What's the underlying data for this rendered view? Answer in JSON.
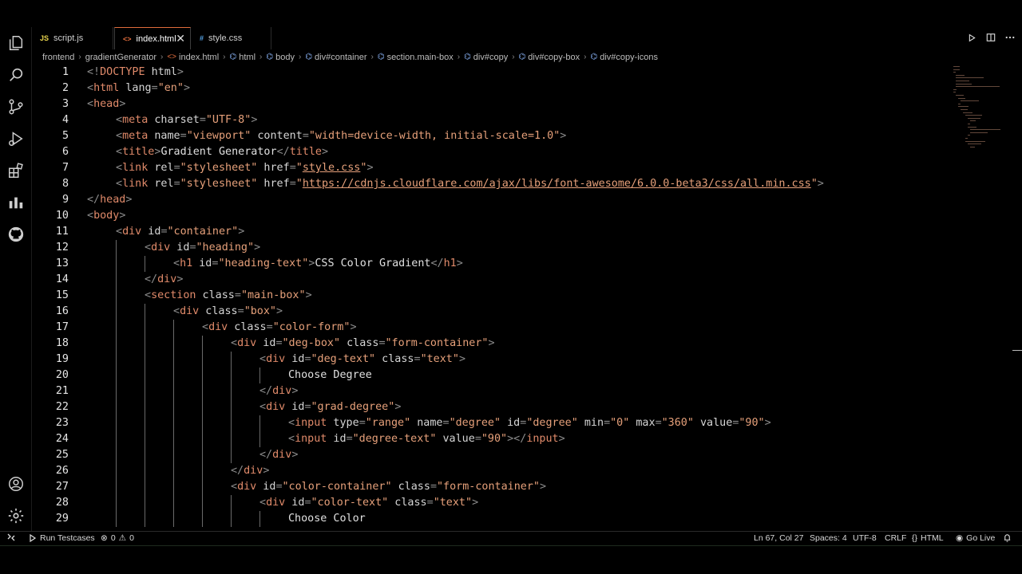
{
  "tabs": [
    {
      "icon": "JS",
      "label": "script.js",
      "active": false
    },
    {
      "icon": "<>",
      "label": "index.html",
      "active": true,
      "close": "✕"
    },
    {
      "icon": "#",
      "label": "style.css",
      "active": false
    }
  ],
  "breadcrumb": [
    "frontend",
    "gradientGenerator",
    "index.html",
    "html",
    "body",
    "div#container",
    "section.main-box",
    "div#copy",
    "div#copy-box",
    "div#copy-icons"
  ],
  "code_lines": [
    {
      "n": "1",
      "indent": 0,
      "tokens": [
        [
          "d",
          "<!"
        ],
        [
          "t",
          "DOCTYPE"
        ],
        [
          "a",
          " html"
        ],
        [
          "d",
          ">"
        ]
      ]
    },
    {
      "n": "2",
      "indent": 0,
      "tokens": [
        [
          "d",
          "<"
        ],
        [
          "t",
          "html"
        ],
        [
          "a",
          " lang"
        ],
        [
          "d",
          "="
        ],
        [
          "s",
          "\"en\""
        ],
        [
          "d",
          ">"
        ]
      ]
    },
    {
      "n": "3",
      "indent": 0,
      "tokens": [
        [
          "d",
          "<"
        ],
        [
          "t",
          "head"
        ],
        [
          "d",
          ">"
        ]
      ]
    },
    {
      "n": "4",
      "indent": 1,
      "tokens": [
        [
          "d",
          "<"
        ],
        [
          "t",
          "meta"
        ],
        [
          "a",
          " charset"
        ],
        [
          "d",
          "="
        ],
        [
          "s",
          "\"UTF-8\""
        ],
        [
          "d",
          ">"
        ]
      ]
    },
    {
      "n": "5",
      "indent": 1,
      "tokens": [
        [
          "d",
          "<"
        ],
        [
          "t",
          "meta"
        ],
        [
          "a",
          " name"
        ],
        [
          "d",
          "="
        ],
        [
          "s",
          "\"viewport\""
        ],
        [
          "a",
          " content"
        ],
        [
          "d",
          "="
        ],
        [
          "s",
          "\"width=device-width, initial-scale=1.0\""
        ],
        [
          "d",
          ">"
        ]
      ]
    },
    {
      "n": "6",
      "indent": 1,
      "tokens": [
        [
          "d",
          "<"
        ],
        [
          "t",
          "title"
        ],
        [
          "d",
          ">"
        ],
        [
          "x",
          "Gradient Generator"
        ],
        [
          "d",
          "</"
        ],
        [
          "t",
          "title"
        ],
        [
          "d",
          ">"
        ]
      ]
    },
    {
      "n": "7",
      "indent": 1,
      "tokens": [
        [
          "d",
          "<"
        ],
        [
          "t",
          "link"
        ],
        [
          "a",
          " rel"
        ],
        [
          "d",
          "="
        ],
        [
          "s",
          "\"stylesheet\""
        ],
        [
          "a",
          " href"
        ],
        [
          "d",
          "="
        ],
        [
          "s",
          "\""
        ],
        [
          "u",
          "style.css"
        ],
        [
          "s",
          "\""
        ],
        [
          "d",
          ">"
        ]
      ]
    },
    {
      "n": "8",
      "indent": 1,
      "tokens": [
        [
          "d",
          "<"
        ],
        [
          "t",
          "link"
        ],
        [
          "a",
          " rel"
        ],
        [
          "d",
          "="
        ],
        [
          "s",
          "\"stylesheet\""
        ],
        [
          "a",
          " href"
        ],
        [
          "d",
          "="
        ],
        [
          "s",
          "\""
        ],
        [
          "u",
          "https://cdnjs.cloudflare.com/ajax/libs/font-awesome/6.0.0-beta3/css/all.min.css"
        ],
        [
          "s",
          "\""
        ],
        [
          "d",
          ">"
        ]
      ]
    },
    {
      "n": "9",
      "indent": 0,
      "tokens": [
        [
          "d",
          "</"
        ],
        [
          "t",
          "head"
        ],
        [
          "d",
          ">"
        ]
      ]
    },
    {
      "n": "10",
      "indent": 0,
      "tokens": [
        [
          "d",
          "<"
        ],
        [
          "t",
          "body"
        ],
        [
          "d",
          ">"
        ]
      ]
    },
    {
      "n": "11",
      "indent": 1,
      "tokens": [
        [
          "d",
          "<"
        ],
        [
          "t",
          "div"
        ],
        [
          "a",
          " id"
        ],
        [
          "d",
          "="
        ],
        [
          "s",
          "\"container\""
        ],
        [
          "d",
          ">"
        ]
      ]
    },
    {
      "n": "12",
      "indent": 2,
      "tokens": [
        [
          "d",
          "<"
        ],
        [
          "t",
          "div"
        ],
        [
          "a",
          " id"
        ],
        [
          "d",
          "="
        ],
        [
          "s",
          "\"heading\""
        ],
        [
          "d",
          ">"
        ]
      ]
    },
    {
      "n": "13",
      "indent": 3,
      "tokens": [
        [
          "d",
          "<"
        ],
        [
          "t",
          "h1"
        ],
        [
          "a",
          " id"
        ],
        [
          "d",
          "="
        ],
        [
          "s",
          "\"heading-text\""
        ],
        [
          "d",
          ">"
        ],
        [
          "x",
          "CSS Color Gradient"
        ],
        [
          "d",
          "</"
        ],
        [
          "t",
          "h1"
        ],
        [
          "d",
          ">"
        ]
      ]
    },
    {
      "n": "14",
      "indent": 2,
      "tokens": [
        [
          "d",
          "</"
        ],
        [
          "t",
          "div"
        ],
        [
          "d",
          ">"
        ]
      ]
    },
    {
      "n": "15",
      "indent": 2,
      "tokens": [
        [
          "d",
          "<"
        ],
        [
          "t",
          "section"
        ],
        [
          "a",
          " class"
        ],
        [
          "d",
          "="
        ],
        [
          "s",
          "\"main-box\""
        ],
        [
          "d",
          ">"
        ]
      ]
    },
    {
      "n": "16",
      "indent": 3,
      "tokens": [
        [
          "d",
          "<"
        ],
        [
          "t",
          "div"
        ],
        [
          "a",
          " class"
        ],
        [
          "d",
          "="
        ],
        [
          "s",
          "\"box\""
        ],
        [
          "d",
          ">"
        ]
      ]
    },
    {
      "n": "17",
      "indent": 4,
      "tokens": [
        [
          "d",
          "<"
        ],
        [
          "t",
          "div"
        ],
        [
          "a",
          " class"
        ],
        [
          "d",
          "="
        ],
        [
          "s",
          "\"color-form\""
        ],
        [
          "d",
          ">"
        ]
      ]
    },
    {
      "n": "18",
      "indent": 5,
      "tokens": [
        [
          "d",
          "<"
        ],
        [
          "t",
          "div"
        ],
        [
          "a",
          " id"
        ],
        [
          "d",
          "="
        ],
        [
          "s",
          "\"deg-box\""
        ],
        [
          "a",
          " class"
        ],
        [
          "d",
          "="
        ],
        [
          "s",
          "\"form-container\""
        ],
        [
          "d",
          ">"
        ]
      ]
    },
    {
      "n": "19",
      "indent": 6,
      "tokens": [
        [
          "d",
          "<"
        ],
        [
          "t",
          "div"
        ],
        [
          "a",
          " id"
        ],
        [
          "d",
          "="
        ],
        [
          "s",
          "\"deg-text\""
        ],
        [
          "a",
          " class"
        ],
        [
          "d",
          "="
        ],
        [
          "s",
          "\"text\""
        ],
        [
          "d",
          ">"
        ]
      ]
    },
    {
      "n": "20",
      "indent": 7,
      "tokens": [
        [
          "x",
          "Choose Degree"
        ]
      ]
    },
    {
      "n": "21",
      "indent": 6,
      "tokens": [
        [
          "d",
          "</"
        ],
        [
          "t",
          "div"
        ],
        [
          "d",
          ">"
        ]
      ]
    },
    {
      "n": "22",
      "indent": 6,
      "tokens": [
        [
          "d",
          "<"
        ],
        [
          "t",
          "div"
        ],
        [
          "a",
          " id"
        ],
        [
          "d",
          "="
        ],
        [
          "s",
          "\"grad-degree\""
        ],
        [
          "d",
          ">"
        ]
      ]
    },
    {
      "n": "23",
      "indent": 7,
      "tokens": [
        [
          "d",
          "<"
        ],
        [
          "t",
          "input"
        ],
        [
          "a",
          " type"
        ],
        [
          "d",
          "="
        ],
        [
          "s",
          "\"range\""
        ],
        [
          "a",
          " name"
        ],
        [
          "d",
          "="
        ],
        [
          "s",
          "\"degree\""
        ],
        [
          "a",
          " id"
        ],
        [
          "d",
          "="
        ],
        [
          "s",
          "\"degree\""
        ],
        [
          "a",
          " min"
        ],
        [
          "d",
          "="
        ],
        [
          "s",
          "\"0\""
        ],
        [
          "a",
          " max"
        ],
        [
          "d",
          "="
        ],
        [
          "s",
          "\"360\""
        ],
        [
          "a",
          " value"
        ],
        [
          "d",
          "="
        ],
        [
          "s",
          "\"90\""
        ],
        [
          "d",
          ">"
        ]
      ]
    },
    {
      "n": "24",
      "indent": 7,
      "tokens": [
        [
          "d",
          "<"
        ],
        [
          "t",
          "input"
        ],
        [
          "a",
          " id"
        ],
        [
          "d",
          "="
        ],
        [
          "s",
          "\"degree-text\""
        ],
        [
          "a",
          " value"
        ],
        [
          "d",
          "="
        ],
        [
          "s",
          "\"90\""
        ],
        [
          "d",
          "></"
        ],
        [
          "t",
          "input"
        ],
        [
          "d",
          ">"
        ]
      ]
    },
    {
      "n": "25",
      "indent": 6,
      "tokens": [
        [
          "d",
          "</"
        ],
        [
          "t",
          "div"
        ],
        [
          "d",
          ">"
        ]
      ]
    },
    {
      "n": "26",
      "indent": 5,
      "tokens": [
        [
          "d",
          "</"
        ],
        [
          "t",
          "div"
        ],
        [
          "d",
          ">"
        ]
      ]
    },
    {
      "n": "27",
      "indent": 5,
      "tokens": [
        [
          "d",
          "<"
        ],
        [
          "t",
          "div"
        ],
        [
          "a",
          " id"
        ],
        [
          "d",
          "="
        ],
        [
          "s",
          "\"color-container\""
        ],
        [
          "a",
          " class"
        ],
        [
          "d",
          "="
        ],
        [
          "s",
          "\"form-container\""
        ],
        [
          "d",
          ">"
        ]
      ]
    },
    {
      "n": "28",
      "indent": 6,
      "tokens": [
        [
          "d",
          "<"
        ],
        [
          "t",
          "div"
        ],
        [
          "a",
          " id"
        ],
        [
          "d",
          "="
        ],
        [
          "s",
          "\"color-text\""
        ],
        [
          "a",
          " class"
        ],
        [
          "d",
          "="
        ],
        [
          "s",
          "\"text\""
        ],
        [
          "d",
          ">"
        ]
      ]
    },
    {
      "n": "29",
      "indent": 7,
      "tokens": [
        [
          "x",
          "Choose Color"
        ]
      ]
    }
  ],
  "status": {
    "remote_icon": "remote-icon",
    "run_testcases": "Run Testcases",
    "errors": "0",
    "warnings": "0",
    "position": "Ln 67, Col 27",
    "spaces": "Spaces: 4",
    "encoding": "UTF-8",
    "eol": "CRLF",
    "language": "HTML",
    "go_live": "Go Live"
  },
  "colors": {
    "tag": "#e08a6a",
    "string": "#e6a07a",
    "punct": "#8b8b8b",
    "active_tab_border": "#e06c3c"
  }
}
